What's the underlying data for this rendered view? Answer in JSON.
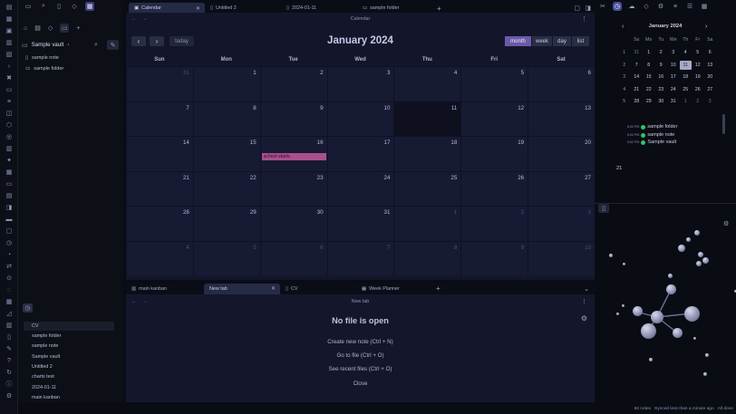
{
  "left_sidebar": {
    "vault_name": "Sample vault",
    "files": [
      {
        "name": "sample note"
      },
      {
        "name": "sample folder"
      }
    ],
    "recent": [
      "CV",
      "sample folder",
      "sample note",
      "Sample vault",
      "Untitled 2",
      "charts test",
      "2024-01-11",
      "main kanban"
    ]
  },
  "top_tabs": [
    {
      "label": "Calendar"
    },
    {
      "label": "Untitled 2"
    },
    {
      "label": "2024-01-11"
    },
    {
      "label": "sample folder"
    }
  ],
  "calendar": {
    "pane_title": "Calendar",
    "today_label": "today",
    "month_title": "January 2024",
    "views": [
      "month",
      "week",
      "day",
      "list"
    ],
    "weekdays": [
      "Sun",
      "Mon",
      "Tue",
      "Wed",
      "Thu",
      "Fri",
      "Sat"
    ],
    "weeks": [
      [
        "31",
        "1",
        "2",
        "3",
        "4",
        "5",
        "6"
      ],
      [
        "7",
        "8",
        "9",
        "10",
        "11",
        "12",
        "13"
      ],
      [
        "14",
        "15",
        "16",
        "17",
        "18",
        "19",
        "20"
      ],
      [
        "21",
        "22",
        "23",
        "24",
        "25",
        "26",
        "27"
      ],
      [
        "28",
        "29",
        "30",
        "31",
        "1",
        "2",
        "3"
      ],
      [
        "4",
        "5",
        "6",
        "7",
        "8",
        "9",
        "10"
      ]
    ],
    "event": {
      "label": "school starts"
    }
  },
  "bottom_tabs": [
    {
      "label": "main kanban"
    },
    {
      "label": "New tab"
    },
    {
      "label": "CV"
    },
    {
      "label": "Week Planner"
    }
  ],
  "new_tab": {
    "pane_title": "New tab",
    "title": "No file is open",
    "links": [
      "Create new note (Ctrl + N)",
      "Go to file (Ctrl + O)",
      "See recent files (Ctrl + O)",
      "Close"
    ]
  },
  "mini_calendar": {
    "title": "January 2024",
    "headers": [
      "Su",
      "Mo",
      "Tu",
      "We",
      "Th",
      "Fr",
      "Sa"
    ],
    "rows": [
      {
        "wk": "1",
        "days": [
          "31",
          "1",
          "2",
          "3",
          "4",
          "5",
          "6"
        ]
      },
      {
        "wk": "2",
        "days": [
          "7",
          "8",
          "9",
          "10",
          "11",
          "12",
          "13"
        ]
      },
      {
        "wk": "3",
        "days": [
          "14",
          "15",
          "16",
          "17",
          "18",
          "19",
          "20"
        ]
      },
      {
        "wk": "4",
        "days": [
          "21",
          "22",
          "23",
          "24",
          "25",
          "26",
          "27"
        ]
      },
      {
        "wk": "5",
        "days": [
          "28",
          "29",
          "30",
          "31",
          "1",
          "2",
          "3"
        ]
      }
    ],
    "notes": [
      {
        "time": "5:02 PM",
        "label": "sample folder"
      },
      {
        "time": "5:02 PM",
        "label": "sample note"
      },
      {
        "time": "5:02 PM",
        "label": "Sample vault"
      }
    ],
    "week_label": "21"
  },
  "status": {
    "notes": "62 notes",
    "sync": "Synced less than a minute ago",
    "done": "All done"
  },
  "colors": {
    "accent": "#6b5aa8",
    "event": "#a84f8d",
    "sync_dot": "#33c26b"
  }
}
